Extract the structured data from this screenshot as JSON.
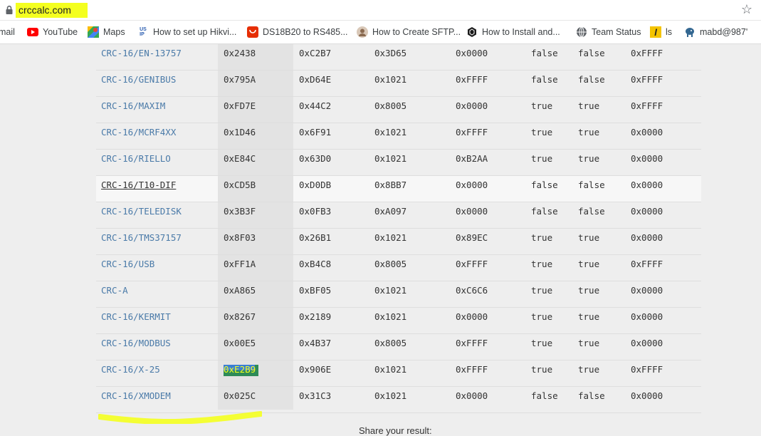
{
  "browser": {
    "url": "crccalc.com",
    "bookmarks": [
      {
        "label": "mail",
        "icon": "gmail-icon"
      },
      {
        "label": "YouTube",
        "icon": "youtube-icon"
      },
      {
        "label": "Maps",
        "icon": "maps-icon"
      },
      {
        "label": "How to set up Hikvi...",
        "icon": "usip-icon"
      },
      {
        "label": "DS18B20 to RS485...",
        "icon": "aliexpress-icon"
      },
      {
        "label": "How to Create SFTP...",
        "icon": "avatar-icon"
      },
      {
        "label": "How to Install and...",
        "icon": "hexagon-icon"
      },
      {
        "label": "Team Status",
        "icon": "globe-icon"
      },
      {
        "label": "ls",
        "icon": "l-icon"
      },
      {
        "label": "mabd@987'",
        "icon": "elephant-icon"
      }
    ]
  },
  "table": {
    "rows": [
      {
        "name": "CRC-16/EN-13757",
        "result": "0x2438",
        "check": "0xC2B7",
        "poly": "0x3D65",
        "init": "0x0000",
        "refin": "false",
        "refout": "false",
        "xorout": "0xFFFF"
      },
      {
        "name": "CRC-16/GENIBUS",
        "result": "0x795A",
        "check": "0xD64E",
        "poly": "0x1021",
        "init": "0xFFFF",
        "refin": "false",
        "refout": "false",
        "xorout": "0xFFFF"
      },
      {
        "name": "CRC-16/MAXIM",
        "result": "0xFD7E",
        "check": "0x44C2",
        "poly": "0x8005",
        "init": "0x0000",
        "refin": "true",
        "refout": "true",
        "xorout": "0xFFFF"
      },
      {
        "name": "CRC-16/MCRF4XX",
        "result": "0x1D46",
        "check": "0x6F91",
        "poly": "0x1021",
        "init": "0xFFFF",
        "refin": "true",
        "refout": "true",
        "xorout": "0x0000"
      },
      {
        "name": "CRC-16/RIELLO",
        "result": "0xE84C",
        "check": "0x63D0",
        "poly": "0x1021",
        "init": "0xB2AA",
        "refin": "true",
        "refout": "true",
        "xorout": "0x0000"
      },
      {
        "name": "CRC-16/T10-DIF",
        "result": "0xCD5B",
        "check": "0xD0DB",
        "poly": "0x8BB7",
        "init": "0x0000",
        "refin": "false",
        "refout": "false",
        "xorout": "0x0000"
      },
      {
        "name": "CRC-16/TELEDISK",
        "result": "0x3B3F",
        "check": "0x0FB3",
        "poly": "0xA097",
        "init": "0x0000",
        "refin": "false",
        "refout": "false",
        "xorout": "0x0000"
      },
      {
        "name": "CRC-16/TMS37157",
        "result": "0x8F03",
        "check": "0x26B1",
        "poly": "0x1021",
        "init": "0x89EC",
        "refin": "true",
        "refout": "true",
        "xorout": "0x0000"
      },
      {
        "name": "CRC-16/USB",
        "result": "0xFF1A",
        "check": "0xB4C8",
        "poly": "0x8005",
        "init": "0xFFFF",
        "refin": "true",
        "refout": "true",
        "xorout": "0xFFFF"
      },
      {
        "name": "CRC-A",
        "result": "0xA865",
        "check": "0xBF05",
        "poly": "0x1021",
        "init": "0xC6C6",
        "refin": "true",
        "refout": "true",
        "xorout": "0x0000"
      },
      {
        "name": "CRC-16/KERMIT",
        "result": "0x8267",
        "check": "0x2189",
        "poly": "0x1021",
        "init": "0x0000",
        "refin": "true",
        "refout": "true",
        "xorout": "0x0000"
      },
      {
        "name": "CRC-16/MODBUS",
        "result": "0x00E5",
        "check": "0x4B37",
        "poly": "0x8005",
        "init": "0xFFFF",
        "refin": "true",
        "refout": "true",
        "xorout": "0x0000"
      },
      {
        "name": "CRC-16/X-25",
        "result": "0xE2B9",
        "check": "0x906E",
        "poly": "0x1021",
        "init": "0xFFFF",
        "refin": "true",
        "refout": "true",
        "xorout": "0xFFFF"
      },
      {
        "name": "CRC-16/XMODEM",
        "result": "0x025C",
        "check": "0x31C3",
        "poly": "0x1021",
        "init": "0x0000",
        "refin": "false",
        "refout": "false",
        "xorout": "0x0000"
      }
    ]
  },
  "footer": {
    "share_label": "Share your result:"
  },
  "colors": {
    "link": "#4a7aa8",
    "highlighter": "#f4ff1f",
    "selection": "#2e8b57"
  }
}
